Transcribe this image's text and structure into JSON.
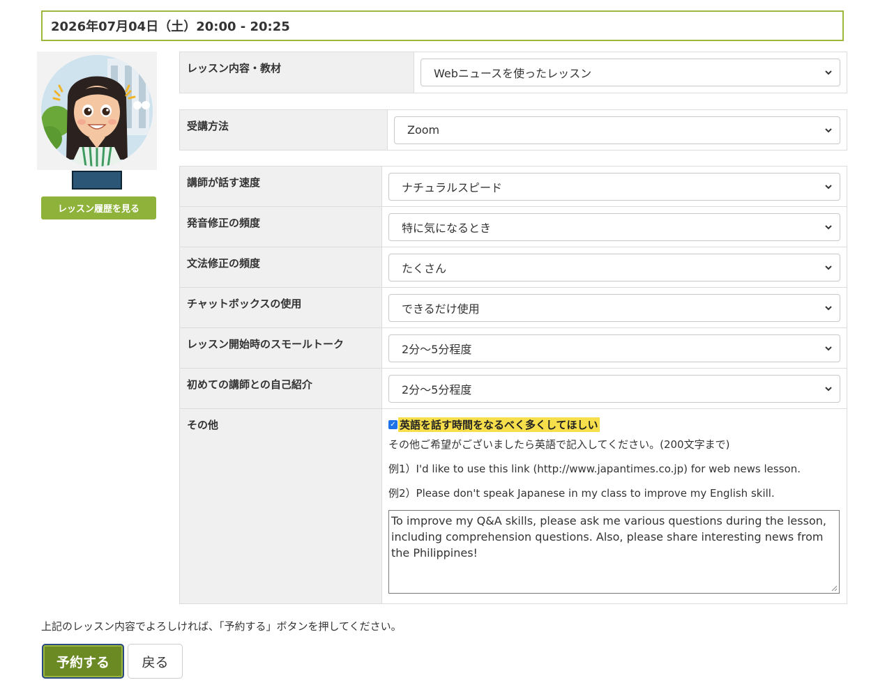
{
  "header": {
    "datetime": "2026年07月04日（土）20:00 - 20:25"
  },
  "teacher": {
    "history_button": "レッスン履歴を見る"
  },
  "lesson": {
    "label": "レッスン内容・教材",
    "value": "Webニュースを使ったレッスン"
  },
  "method": {
    "label": "受講方法",
    "value": "Zoom"
  },
  "prefs": [
    {
      "label": "講師が話す速度",
      "value": "ナチュラルスピード"
    },
    {
      "label": "発音修正の頻度",
      "value": "特に気になるとき"
    },
    {
      "label": "文法修正の頻度",
      "value": "たくさん"
    },
    {
      "label": "チャットボックスの使用",
      "value": "できるだけ使用"
    },
    {
      "label": "レッスン開始時のスモールトーク",
      "value": "2分〜5分程度"
    },
    {
      "label": "初めての講師との自己紹介",
      "value": "2分〜5分程度"
    }
  ],
  "other": {
    "label": "その他",
    "checkbox_label": "英語を話す時間をなるべく多くしてほしい",
    "note": "その他ご希望がございましたら英語で記入してください。(200文字まで)",
    "example1": "例1）I'd like to use this link (http://www.japantimes.co.jp) for web news lesson.",
    "example2": "例2）Please don't speak Japanese in my class to improve my English skill.",
    "textarea_value": "To improve my Q&A skills, please ask me various questions during the lesson, including comprehension questions. Also, please share interesting news from the Philippines!"
  },
  "footer": {
    "confirm_text": "上記のレッスン内容でよろしければ、「予約する」ボタンを押してください。",
    "reserve_button": "予約する",
    "back_button": "戻る"
  },
  "colors": {
    "accent": "#8fb33a",
    "reserve_bg": "#6c8a23",
    "highlight": "#f7df4c",
    "redaction": "#2c5675"
  },
  "icons": {
    "select_arrow": "chevron-down-icon",
    "checkbox": "check-icon",
    "resize": "resize-grip-icon"
  }
}
